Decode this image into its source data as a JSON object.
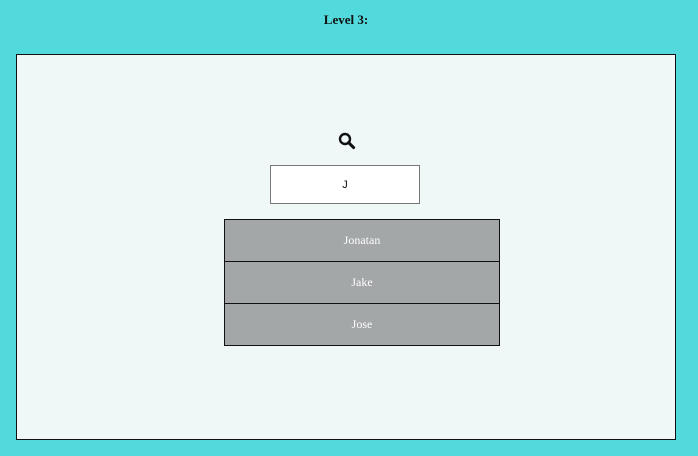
{
  "header": {
    "title": "Level 3:"
  },
  "search": {
    "icon": "search-icon",
    "value": "J"
  },
  "results": [
    {
      "label": "Jonatan"
    },
    {
      "label": "Jake"
    },
    {
      "label": "Jose"
    }
  ],
  "colors": {
    "background": "#52d9db",
    "panel": "#eff8f7",
    "result_item": "#a3a7a7",
    "result_text": "#ffffff"
  }
}
